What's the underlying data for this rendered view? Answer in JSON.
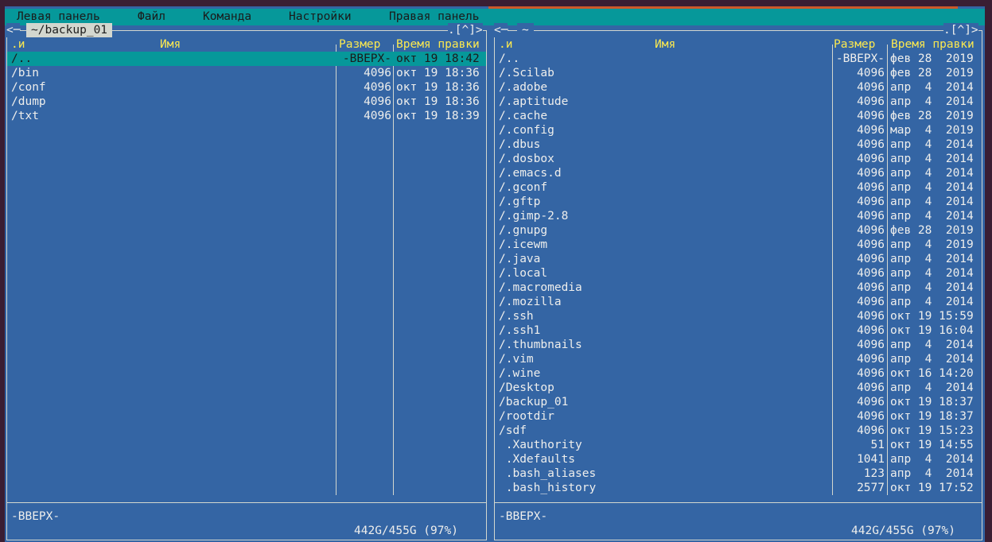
{
  "menu": [
    "Левая панель",
    "Файл",
    "Команда",
    "Настройки",
    "Правая панель"
  ],
  "left": {
    "path": "~/backup_01",
    "corner_left": "<─",
    "corner_right": ".[^]>",
    "headers": {
      "sort": ".и",
      "name": "Имя",
      "size": "Размер",
      "time": "Время правки"
    },
    "rows": [
      {
        "name": "/..",
        "size": "-ВВЕРХ-",
        "time": "окт 19 18:42",
        "selected": true
      },
      {
        "name": "/bin",
        "size": "4096",
        "time": "окт 19 18:36"
      },
      {
        "name": "/conf",
        "size": "4096",
        "time": "окт 19 18:36"
      },
      {
        "name": "/dump",
        "size": "4096",
        "time": "окт 19 18:36"
      },
      {
        "name": "/txt",
        "size": "4096",
        "time": "окт 19 18:39"
      }
    ],
    "status": "-ВВЕРХ-",
    "disk": "442G/455G (97%)"
  },
  "right": {
    "path": "~",
    "corner_left": "<─",
    "corner_right": ".[^]>",
    "headers": {
      "sort": ".и",
      "name": "Имя",
      "size": "Размер",
      "time": "Время правки"
    },
    "rows": [
      {
        "name": "/..",
        "size": "-ВВЕРХ-",
        "time": "фев 28  2019"
      },
      {
        "name": "/.Scilab",
        "size": "4096",
        "time": "фев 28  2019"
      },
      {
        "name": "/.adobe",
        "size": "4096",
        "time": "апр  4  2014"
      },
      {
        "name": "/.aptitude",
        "size": "4096",
        "time": "апр  4  2014"
      },
      {
        "name": "/.cache",
        "size": "4096",
        "time": "фев 28  2019"
      },
      {
        "name": "/.config",
        "size": "4096",
        "time": "мар  4  2019"
      },
      {
        "name": "/.dbus",
        "size": "4096",
        "time": "апр  4  2014"
      },
      {
        "name": "/.dosbox",
        "size": "4096",
        "time": "апр  4  2014"
      },
      {
        "name": "/.emacs.d",
        "size": "4096",
        "time": "апр  4  2014"
      },
      {
        "name": "/.gconf",
        "size": "4096",
        "time": "апр  4  2014"
      },
      {
        "name": "/.gftp",
        "size": "4096",
        "time": "апр  4  2014"
      },
      {
        "name": "/.gimp-2.8",
        "size": "4096",
        "time": "апр  4  2014"
      },
      {
        "name": "/.gnupg",
        "size": "4096",
        "time": "фев 28  2019"
      },
      {
        "name": "/.icewm",
        "size": "4096",
        "time": "апр  4  2019"
      },
      {
        "name": "/.java",
        "size": "4096",
        "time": "апр  4  2014"
      },
      {
        "name": "/.local",
        "size": "4096",
        "time": "апр  4  2014"
      },
      {
        "name": "/.macromedia",
        "size": "4096",
        "time": "апр  4  2014"
      },
      {
        "name": "/.mozilla",
        "size": "4096",
        "time": "апр  4  2014"
      },
      {
        "name": "/.ssh",
        "size": "4096",
        "time": "окт 19 15:59"
      },
      {
        "name": "/.ssh1",
        "size": "4096",
        "time": "окт 19 16:04"
      },
      {
        "name": "/.thumbnails",
        "size": "4096",
        "time": "апр  4  2014"
      },
      {
        "name": "/.vim",
        "size": "4096",
        "time": "апр  4  2014"
      },
      {
        "name": "/.wine",
        "size": "4096",
        "time": "окт 16 14:20"
      },
      {
        "name": "/Desktop",
        "size": "4096",
        "time": "апр  4  2014"
      },
      {
        "name": "/backup_01",
        "size": "4096",
        "time": "окт 19 18:37"
      },
      {
        "name": "/rootdir",
        "size": "4096",
        "time": "окт 19 18:37"
      },
      {
        "name": "/sdf",
        "size": "4096",
        "time": "окт 19 15:23"
      },
      {
        "name": " .Xauthority",
        "size": "51",
        "time": "окт 19 14:55"
      },
      {
        "name": " .Xdefaults",
        "size": "1041",
        "time": "апр  4  2014"
      },
      {
        "name": " .bash_aliases",
        "size": "123",
        "time": "апр  4  2014"
      },
      {
        "name": " .bash_history",
        "size": "2577",
        "time": "окт 19 17:52"
      }
    ],
    "status": "-ВВЕРХ-",
    "disk": "442G/455G (97%)"
  }
}
